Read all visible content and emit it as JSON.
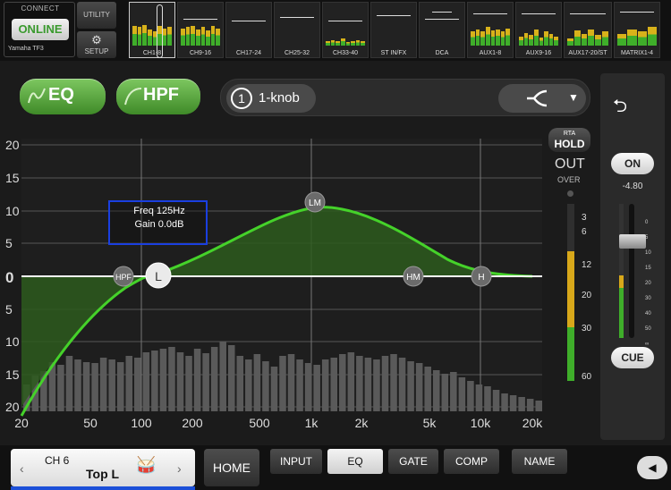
{
  "connect": {
    "title": "CONNECT",
    "status": "ONLINE",
    "device": "Yamaha TF3"
  },
  "utility": {
    "label": "UTILITY"
  },
  "setup": {
    "label": "SETUP",
    "icon": "gear-icon"
  },
  "banks": [
    "CH1-8",
    "CH9-16",
    "CH17-24",
    "CH25-32",
    "CH33-40",
    "ST IN/FX",
    "DCA",
    "AUX1-8",
    "AUX9-16",
    "AUX17-20/ST",
    "MATRIX1-4"
  ],
  "eq_button": {
    "label": "EQ",
    "color": "#5aa83c"
  },
  "hpf_button": {
    "label": "HPF"
  },
  "knob_mode": {
    "number": "1",
    "label": "1-knob"
  },
  "graph": {
    "y_labels": [
      "20",
      "15",
      "10",
      "5",
      "0",
      "5",
      "10",
      "15",
      "20"
    ],
    "x_labels": [
      "20",
      "50",
      "100",
      "200",
      "500",
      "1k",
      "2k",
      "5k",
      "10k",
      "20k"
    ],
    "info": {
      "freq": "Freq  125Hz",
      "gain": "Gain  0.0dB"
    },
    "nodes": {
      "hpf": "HPF",
      "low": "L",
      "low_mid": "LM",
      "high_mid": "HM",
      "high": "H"
    }
  },
  "meter": {
    "rta_small": "RTA",
    "rta_big": "HOLD",
    "out": "OUT",
    "over": "OVER",
    "scale": [
      "3",
      "6",
      "12",
      "20",
      "30",
      "60"
    ]
  },
  "right_panel": {
    "on": "ON",
    "level": "-4.80",
    "cue": "CUE",
    "scale": [
      "0",
      "5",
      "10",
      "15",
      "20",
      "30",
      "40",
      "50",
      "∞"
    ]
  },
  "channel": {
    "number": "CH 6",
    "name": "Top L"
  },
  "bottom": {
    "home": "HOME",
    "tabs": [
      "INPUT",
      "EQ",
      "GATE",
      "COMP",
      "NAME"
    ]
  }
}
